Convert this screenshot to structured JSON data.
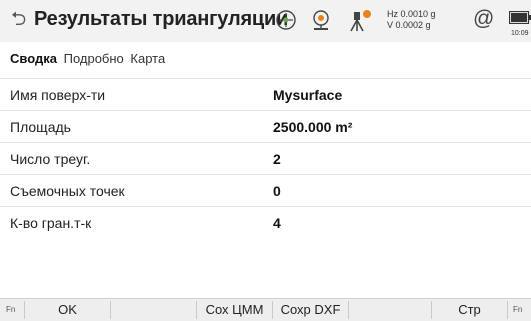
{
  "header": {
    "title": "Результаты триангуляции",
    "hz": "Hz 0.0010 g",
    "v": "V  0.0002 g",
    "at_symbol": "@",
    "clock": "10:09"
  },
  "tabs": [
    "Сводка",
    "Подробно",
    "Карта"
  ],
  "active_tab": "Сводка",
  "rows": [
    {
      "label": "Имя поверх-ти",
      "value": "Mysurface"
    },
    {
      "label": "Площадь",
      "value": "2500.000 m²"
    },
    {
      "label": "Число треуг.",
      "value": "2"
    },
    {
      "label": "Съемочных точек",
      "value": "0"
    },
    {
      "label": "К-во гран.т-к",
      "value": "4"
    }
  ],
  "softkeys": {
    "fn_left": "Fn",
    "ok": "OK",
    "save_dtm": "Сох ЦММ",
    "save_dxf": "Сохр DXF",
    "page": "Стр",
    "fn_right": "Fn"
  },
  "colors": {
    "topbar_bg": "#f2f2f2",
    "icon_orange": "#e8821e",
    "icon_green": "#6aa84f"
  }
}
